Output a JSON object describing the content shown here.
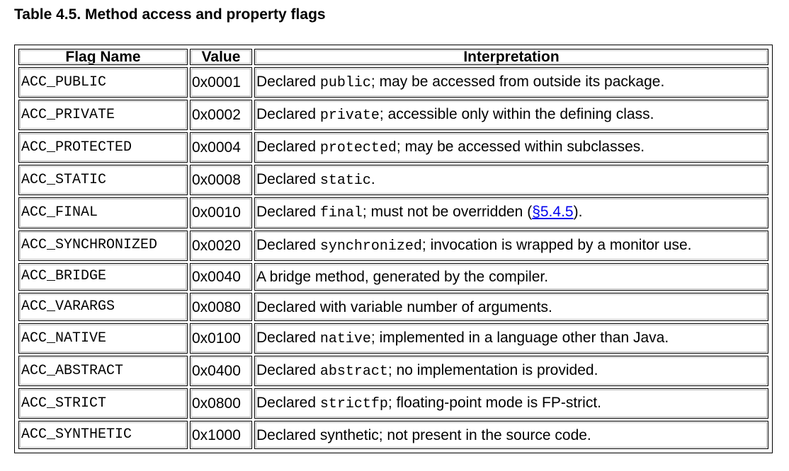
{
  "caption": "Table 4.5. Method access and property flags",
  "headers": {
    "flag_name": "Flag Name",
    "value": "Value",
    "interpretation": "Interpretation"
  },
  "rows": [
    {
      "flag": "ACC_PUBLIC",
      "value": "0x0001",
      "pre": "Declared ",
      "code": "public",
      "post": "; may be accessed from outside its package."
    },
    {
      "flag": "ACC_PRIVATE",
      "value": "0x0002",
      "pre": "Declared ",
      "code": "private",
      "post": "; accessible only within the defining class."
    },
    {
      "flag": "ACC_PROTECTED",
      "value": "0x0004",
      "pre": "Declared ",
      "code": "protected",
      "post": "; may be accessed within subclasses."
    },
    {
      "flag": "ACC_STATIC",
      "value": "0x0008",
      "pre": "Declared ",
      "code": "static",
      "post": "."
    },
    {
      "flag": "ACC_FINAL",
      "value": "0x0010",
      "pre": "Declared ",
      "code": "final",
      "post": "; must not be overridden (",
      "link": "§5.4.5",
      "post2": ")."
    },
    {
      "flag": "ACC_SYNCHRONIZED",
      "value": "0x0020",
      "pre": "Declared ",
      "code": "synchronized",
      "post": "; invocation is wrapped by a monitor use."
    },
    {
      "flag": "ACC_BRIDGE",
      "value": "0x0040",
      "pre": "A bridge method, generated by the compiler."
    },
    {
      "flag": "ACC_VARARGS",
      "value": "0x0080",
      "pre": "Declared with variable number of arguments."
    },
    {
      "flag": "ACC_NATIVE",
      "value": "0x0100",
      "pre": "Declared ",
      "code": "native",
      "post": "; implemented in a language other than Java."
    },
    {
      "flag": "ACC_ABSTRACT",
      "value": "0x0400",
      "pre": "Declared ",
      "code": "abstract",
      "post": "; no implementation is provided."
    },
    {
      "flag": "ACC_STRICT",
      "value": "0x0800",
      "pre": "Declared ",
      "code": "strictfp",
      "post": "; floating-point mode is FP-strict."
    },
    {
      "flag": "ACC_SYNTHETIC",
      "value": "0x1000",
      "pre": "Declared synthetic; not present in the source code."
    }
  ],
  "colors": {
    "link": "#0000ee",
    "border": "#000000",
    "inner_border": "#bdbdbd"
  }
}
